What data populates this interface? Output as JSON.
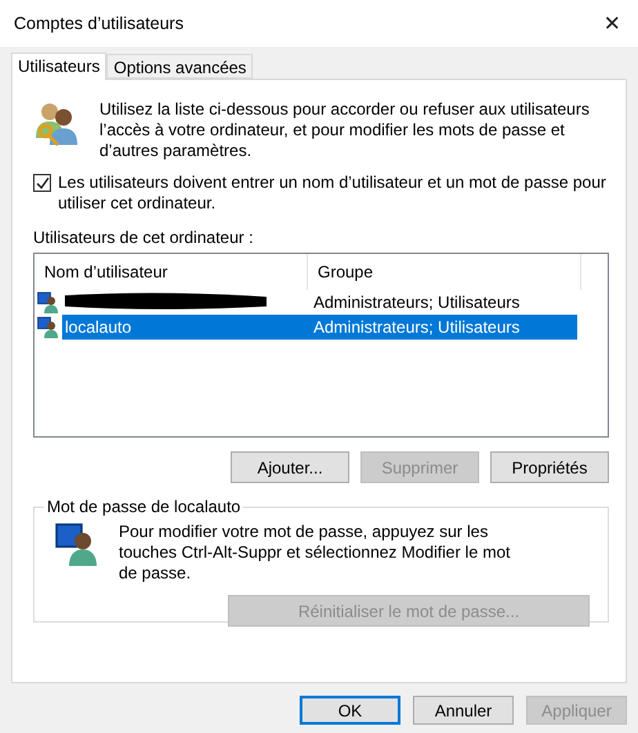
{
  "window": {
    "title": "Comptes d’utilisateurs",
    "close": "✕"
  },
  "tabs": [
    {
      "label": "Utilisateurs",
      "selected": true
    },
    {
      "label": "Options avancées",
      "selected": false
    }
  ],
  "intro": "Utilisez la liste ci-dessous pour accorder ou refuser aux utilisateurs l’accès à votre ordinateur, et pour modifier les mots de passe et d’autres paramètres.",
  "require_login": {
    "label": "Les utilisateurs doivent entrer un nom d’utilisateur et un mot de passe pour utiliser cet ordinateur.",
    "checked": true
  },
  "list_label": "Utilisateurs de cet ordinateur :",
  "table": {
    "columns": [
      "Nom d’utilisateur",
      "Groupe"
    ],
    "rows": [
      {
        "redacted": true,
        "group": "Administrateurs; Utilisateurs",
        "selected": false
      },
      {
        "redacted": false,
        "name": "localauto",
        "group": "Administrateurs; Utilisateurs",
        "selected": true
      }
    ]
  },
  "list_buttons": [
    {
      "label": "Ajouter...",
      "disabled": false
    },
    {
      "label": "Supprimer",
      "disabled": true
    },
    {
      "label": "Propriétés",
      "disabled": false
    }
  ],
  "password_group": {
    "title": "Mot de passe de localauto",
    "text": "Pour modifier votre mot de passe, appuyez sur les touches Ctrl-Alt-Suppr et sélectionnez Modifier le mot de passe.",
    "button": {
      "label": "Réinitialiser le mot de passe...",
      "disabled": true
    }
  },
  "dialog_buttons": [
    {
      "label": "OK",
      "disabled": false,
      "default": true
    },
    {
      "label": "Annuler",
      "disabled": false,
      "default": false
    },
    {
      "label": "Appliquer",
      "disabled": true,
      "default": false
    }
  ]
}
